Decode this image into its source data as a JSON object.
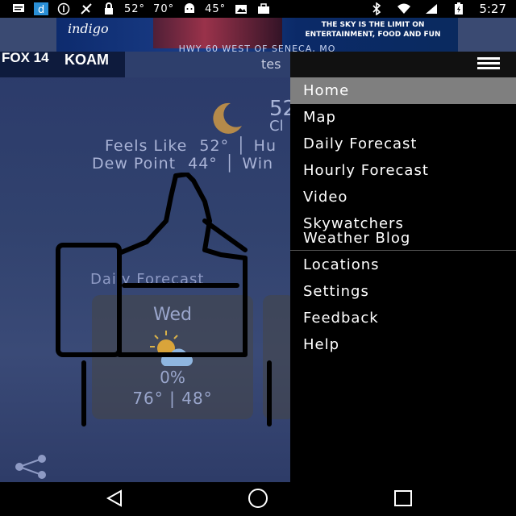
{
  "statusbar": {
    "temps": [
      "52°",
      "70°",
      "45°"
    ],
    "time": "5:27"
  },
  "ad": {
    "logo": "indigo",
    "headline1": "THE SKY IS THE LIMIT ON",
    "headline2": "ENTERTAINMENT, FOOD AND FUN",
    "sub": "HWY 60 WEST OF SENECA, MO"
  },
  "app": {
    "logo_fox": "FOX 14",
    "logo_koam": "KOAM",
    "title": "tes",
    "current": {
      "temp": "52",
      "condition": "Cl",
      "feels_like_label": "Feels Like",
      "feels_like": "52°",
      "humidity_label": "Hu",
      "dew_point_label": "Dew Point",
      "dew_point": "44°",
      "wind_label": "Win"
    },
    "daily_forecast_title": "Daily Forecast",
    "forecast": [
      {
        "day": "Wed",
        "pop": "0%",
        "temps": "76° | 48°"
      }
    ]
  },
  "drawer": {
    "items": [
      {
        "label": "Home",
        "active": true
      },
      {
        "label": "Map"
      },
      {
        "label": "Daily Forecast"
      },
      {
        "label": "Hourly Forecast"
      },
      {
        "label": "Video"
      },
      {
        "label": "Skywatchers Weather Blog"
      },
      {
        "label": "Locations"
      },
      {
        "label": "Settings"
      },
      {
        "label": "Feedback"
      },
      {
        "label": "Help"
      }
    ]
  },
  "colors": {
    "drawer_bg": "#000000",
    "active_item_bg": "#7f7f7f",
    "app_bg": "#2e3c68"
  }
}
